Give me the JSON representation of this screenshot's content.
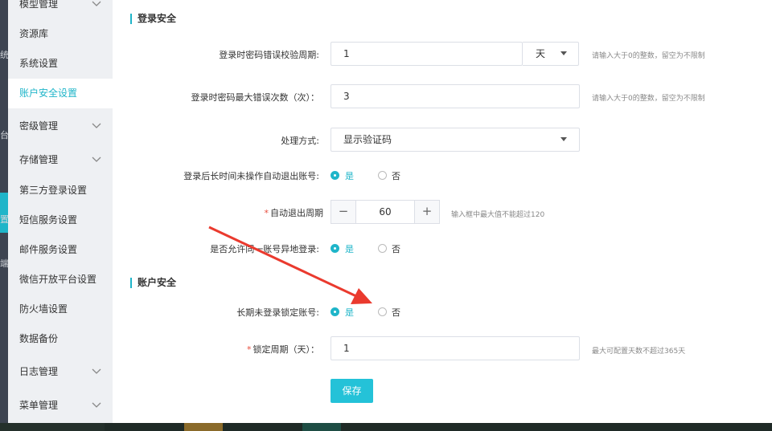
{
  "sidebar": {
    "items": [
      {
        "label": "模型管理",
        "has_chevron": true,
        "active": false
      },
      {
        "label": "资源库",
        "has_chevron": false,
        "active": false
      },
      {
        "label": "系统设置",
        "has_chevron": false,
        "active": false
      },
      {
        "label": "账户安全设置",
        "has_chevron": false,
        "active": true
      },
      {
        "label": "密级管理",
        "has_chevron": true,
        "active": false
      },
      {
        "label": "存储管理",
        "has_chevron": true,
        "active": false
      },
      {
        "label": "第三方登录设置",
        "has_chevron": false,
        "active": false
      },
      {
        "label": "短信服务设置",
        "has_chevron": false,
        "active": false
      },
      {
        "label": "邮件服务设置",
        "has_chevron": false,
        "active": false
      },
      {
        "label": "微信开放平台设置",
        "has_chevron": false,
        "active": false
      },
      {
        "label": "防火墙设置",
        "has_chevron": false,
        "active": false
      },
      {
        "label": "数据备份",
        "has_chevron": false,
        "active": false
      },
      {
        "label": "日志管理",
        "has_chevron": true,
        "active": false
      },
      {
        "label": "菜单管理",
        "has_chevron": true,
        "active": false
      }
    ],
    "strip_glyphs": [
      "统",
      "台",
      "置",
      "端"
    ]
  },
  "login_security": {
    "title": "登录安全",
    "error_period": {
      "label": "登录时密码错误校验周期:",
      "value": "1",
      "unit": "天",
      "hint": "请输入大于0的整数，留空为不限制"
    },
    "max_errors": {
      "label": "登录时密码最大错误次数（次）：",
      "value": "3",
      "hint": "请输入大于0的整数，留空为不限制"
    },
    "handling": {
      "label": "处理方式:",
      "value": "显示验证码"
    },
    "auto_logout": {
      "label": "登录后长时间未操作自动退出账号:",
      "yes": "是",
      "no": "否",
      "selected": "yes"
    },
    "logout_period": {
      "label": "自动退出周期",
      "required_mark": "*",
      "value": "60",
      "minus": "−",
      "plus": "+",
      "hint": "输入框中最大值不能超过120"
    },
    "allow_remote": {
      "label": "是否允许同一账号异地登录:",
      "yes": "是",
      "no": "否",
      "selected": "yes"
    }
  },
  "account_security": {
    "title": "账户安全",
    "lock_inactive": {
      "label": "长期未登录锁定账号:",
      "yes": "是",
      "no": "否",
      "selected": "yes"
    },
    "lock_period": {
      "label": "锁定周期（天）：",
      "required_mark": "*",
      "value": "1",
      "hint": "最大可配置天数不超过365天"
    }
  },
  "save_label": "保存",
  "colors": {
    "accent": "#1fb5c9",
    "sidebar_bg": "#eef0f3",
    "annotation_arrow": "#ea3a2e"
  }
}
